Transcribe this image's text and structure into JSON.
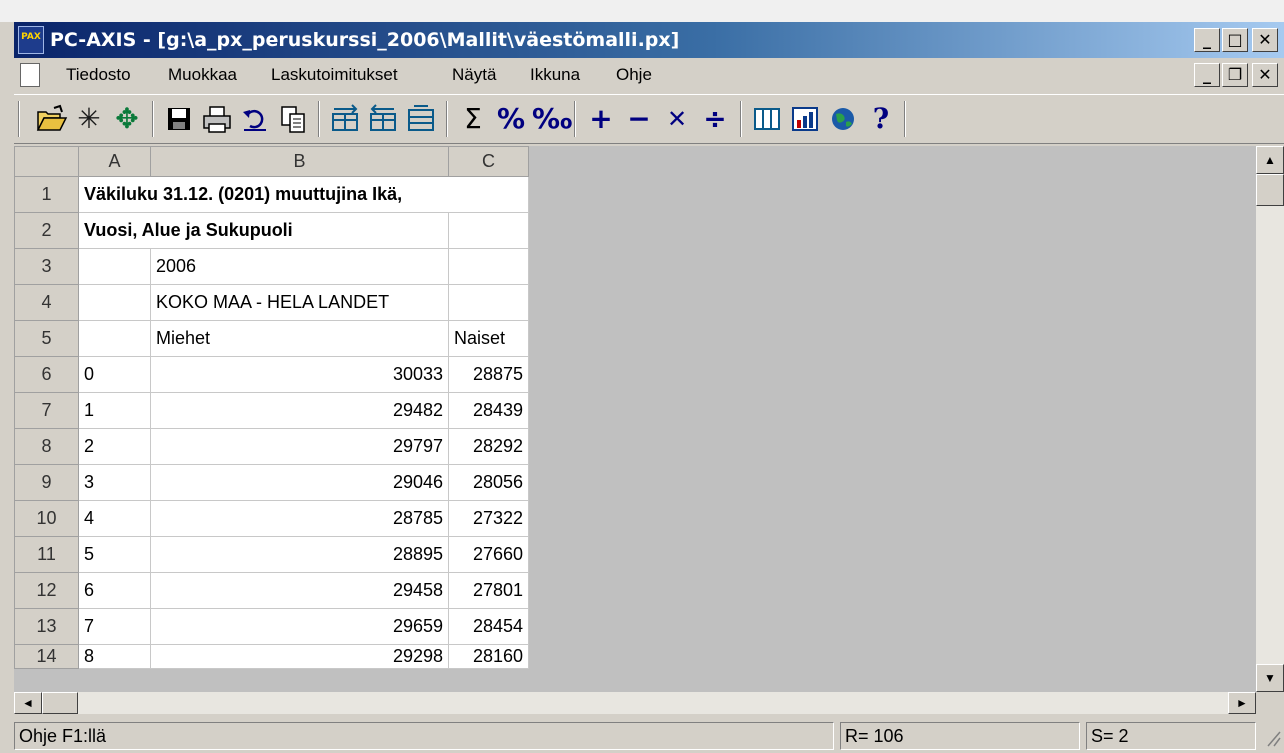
{
  "window": {
    "app_icon_text": "PAX",
    "title": "PC-AXIS - [g:\\a_px_peruskurssi_2006\\Mallit\\väestömalli.px]",
    "buttons": {
      "minimize": "_",
      "maximize": "□",
      "close": "✕",
      "child_minimize": "_",
      "child_restore": "❐",
      "child_close": "✕"
    }
  },
  "menu": {
    "items": [
      "Tiedosto",
      "Muokkaa",
      "Laskutoimitukset",
      "Näytä",
      "Ikkuna",
      "Ohje"
    ]
  },
  "toolbar": {
    "icons": [
      "open-folder-icon",
      "asterisk-icon",
      "move-icon",
      "save-icon",
      "print-icon",
      "undo-icon",
      "copy-icon",
      "pivot-icon",
      "pivot-clockwise-icon",
      "pivot-counter-icon",
      "sum-icon",
      "percent-icon",
      "permille-icon",
      "add-icon",
      "subtract-icon",
      "multiply-icon",
      "divide-icon",
      "table-view-icon",
      "chart-icon",
      "map-icon",
      "help-icon"
    ],
    "glyphs": {
      "asterisk": "✳",
      "move": "✥",
      "sum": "Σ",
      "percent": "%",
      "permille": "‰",
      "add": "+",
      "subtract": "−",
      "multiply": "✕",
      "divide": "÷",
      "help": "?"
    },
    "colors": {
      "operator": "#000080",
      "sum": "#000000"
    }
  },
  "sheet": {
    "column_headers": [
      "A",
      "B",
      "C"
    ],
    "rows": [
      {
        "n": "1",
        "a": "Väkiluku 31.12. (0201) muuttujina Ikä,",
        "b": "",
        "c": ""
      },
      {
        "n": "2",
        "a": "Vuosi, Alue ja Sukupuoli",
        "b": "",
        "c": ""
      },
      {
        "n": "3",
        "a": "",
        "b": "2006",
        "c": ""
      },
      {
        "n": "4",
        "a": "",
        "b": "KOKO MAA - HELA LANDET",
        "c": ""
      },
      {
        "n": "5",
        "a": "",
        "b": "Miehet",
        "c": "Naiset"
      },
      {
        "n": "6",
        "a": "0",
        "b": "30033",
        "c": "28875"
      },
      {
        "n": "7",
        "a": "1",
        "b": "29482",
        "c": "28439"
      },
      {
        "n": "8",
        "a": "2",
        "b": "29797",
        "c": "28292"
      },
      {
        "n": "9",
        "a": "3",
        "b": "29046",
        "c": "28056"
      },
      {
        "n": "10",
        "a": "4",
        "b": "28785",
        "c": "27322"
      },
      {
        "n": "11",
        "a": "5",
        "b": "28895",
        "c": "27660"
      },
      {
        "n": "12",
        "a": "6",
        "b": "29458",
        "c": "27801"
      },
      {
        "n": "13",
        "a": "7",
        "b": "29659",
        "c": "28454"
      },
      {
        "n": "14",
        "a": "8",
        "b": "29298",
        "c": "28160"
      }
    ]
  },
  "scrollbars": {
    "up": "▲",
    "down": "▼",
    "left": "◄",
    "right": "►"
  },
  "status": {
    "help": "Ohje F1:llä",
    "rows": "R= 106",
    "selection": "S= 2"
  }
}
